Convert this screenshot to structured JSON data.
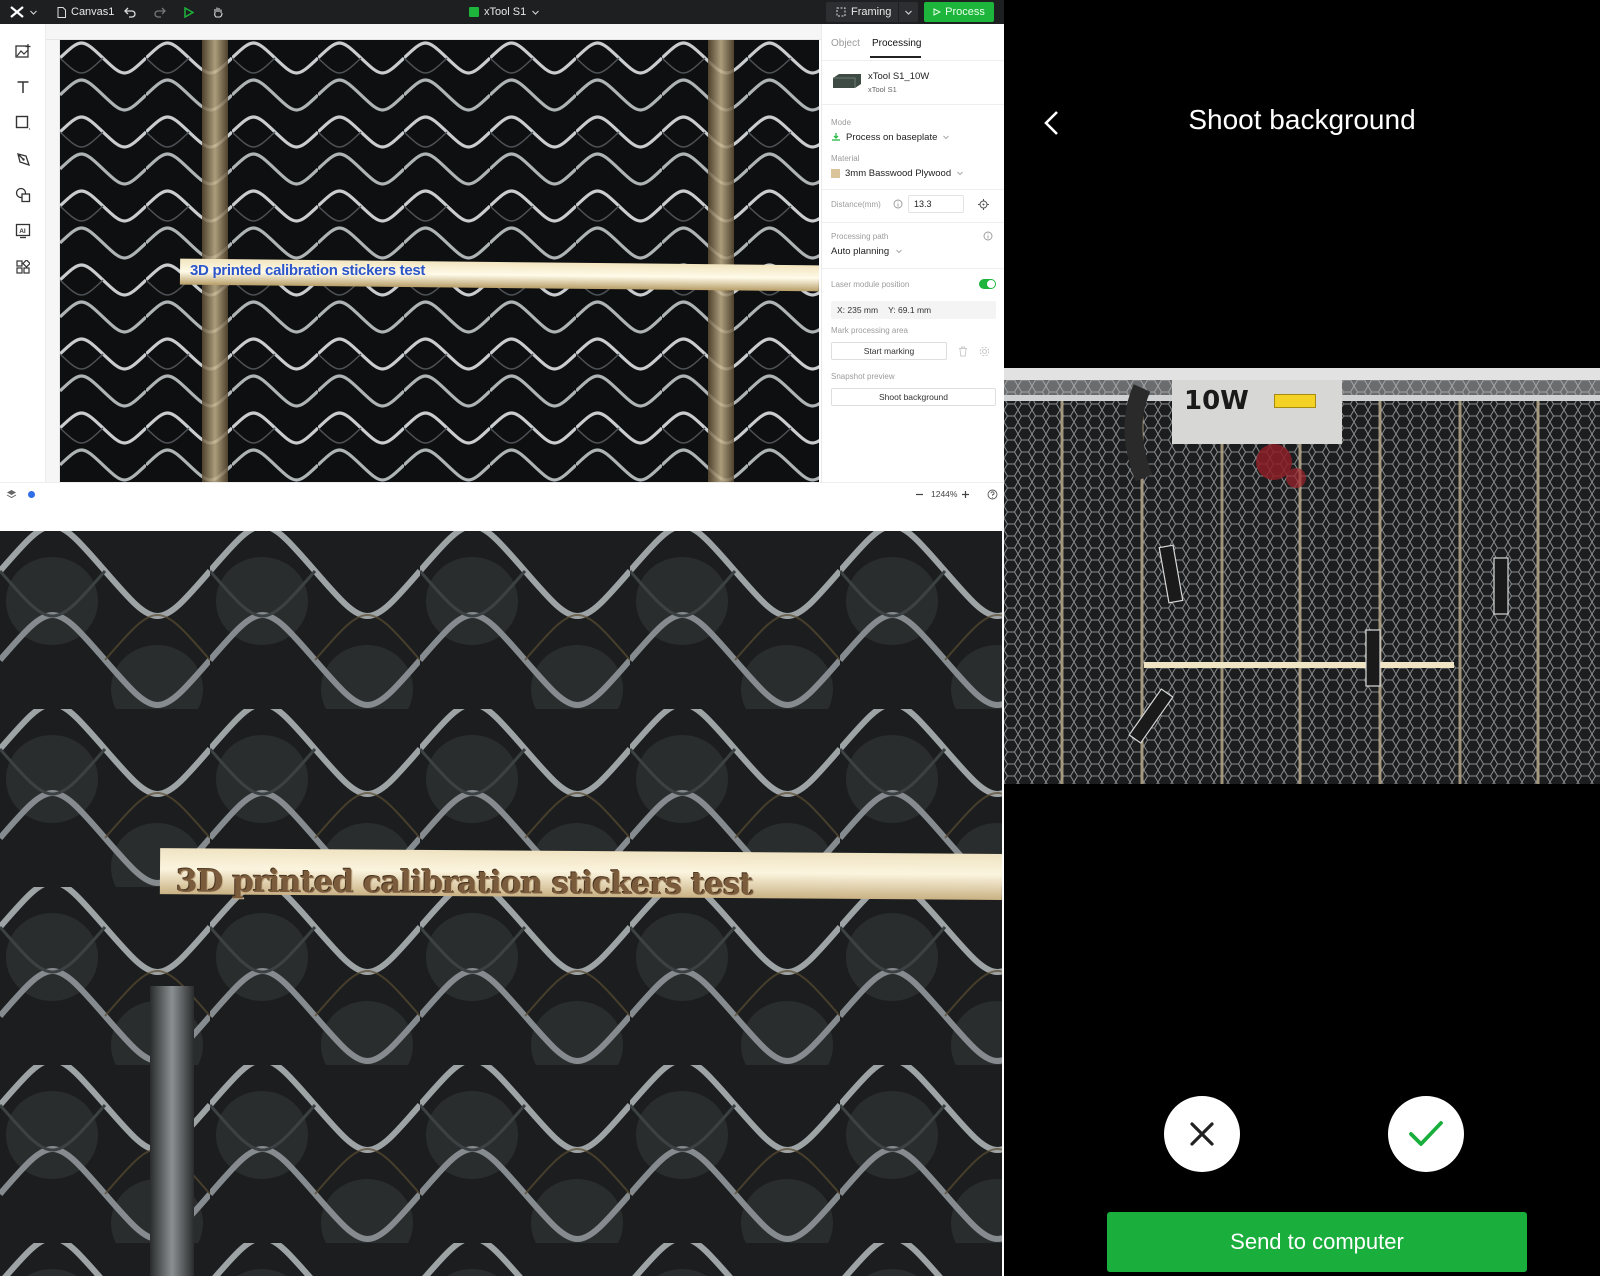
{
  "desktop": {
    "topbar": {
      "file_name": "Canvas1",
      "device_name": "xTool S1",
      "framing_label": "Framing",
      "process_label": "Process"
    },
    "canvas": {
      "overlay_text": "3D printed calibration stickers test"
    },
    "panel": {
      "tabs": [
        {
          "label": "Object",
          "active": false
        },
        {
          "label": "Processing",
          "active": true
        }
      ],
      "device": {
        "name": "xTool S1_10W",
        "model": "xTool S1"
      },
      "mode": {
        "label": "Mode",
        "value": "Process on baseplate"
      },
      "material": {
        "label": "Material",
        "value": "3mm Basswood Plywood"
      },
      "distance": {
        "label": "Distance(mm)",
        "value": "13.3"
      },
      "processing_path": {
        "label": "Processing path",
        "value": "Auto planning"
      },
      "laser_module_position": {
        "label": "Laser module position",
        "enabled": true,
        "x": "X: 235 mm",
        "y": "Y: 69.1 mm"
      },
      "mark_area": {
        "label": "Mark processing area",
        "button": "Start marking"
      },
      "snapshot": {
        "label": "Snapshot preview",
        "button": "Shoot background"
      }
    },
    "status": {
      "zoom": "1244%"
    }
  },
  "closeup": {
    "engraved_text": "3D printed calibration stickers test"
  },
  "phone": {
    "title": "Shoot background",
    "laser_label": "10W",
    "send_button": "Send to computer",
    "cancel_icon": "close-icon",
    "confirm_icon": "check-icon",
    "colors": {
      "accent": "#1aae3d",
      "background": "#000000"
    }
  }
}
